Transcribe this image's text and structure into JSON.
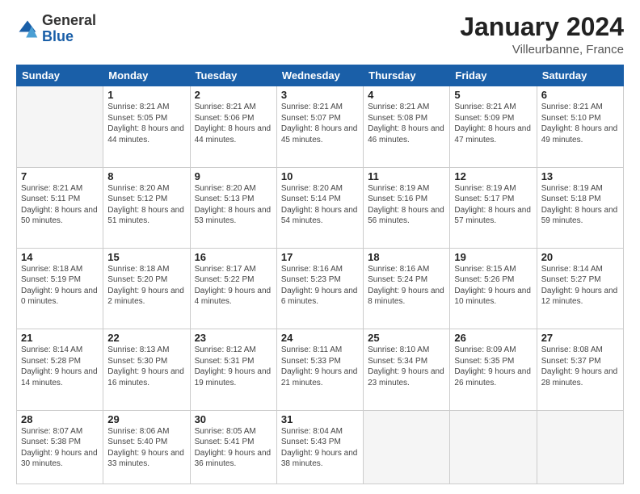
{
  "logo": {
    "general": "General",
    "blue": "Blue"
  },
  "header": {
    "month": "January 2024",
    "location": "Villeurbanne, France"
  },
  "weekdays": [
    "Sunday",
    "Monday",
    "Tuesday",
    "Wednesday",
    "Thursday",
    "Friday",
    "Saturday"
  ],
  "weeks": [
    [
      {
        "day": "",
        "sunrise": "",
        "sunset": "",
        "daylight": "",
        "empty": true
      },
      {
        "day": "1",
        "sunrise": "Sunrise: 8:21 AM",
        "sunset": "Sunset: 5:05 PM",
        "daylight": "Daylight: 8 hours and 44 minutes.",
        "empty": false
      },
      {
        "day": "2",
        "sunrise": "Sunrise: 8:21 AM",
        "sunset": "Sunset: 5:06 PM",
        "daylight": "Daylight: 8 hours and 44 minutes.",
        "empty": false
      },
      {
        "day": "3",
        "sunrise": "Sunrise: 8:21 AM",
        "sunset": "Sunset: 5:07 PM",
        "daylight": "Daylight: 8 hours and 45 minutes.",
        "empty": false
      },
      {
        "day": "4",
        "sunrise": "Sunrise: 8:21 AM",
        "sunset": "Sunset: 5:08 PM",
        "daylight": "Daylight: 8 hours and 46 minutes.",
        "empty": false
      },
      {
        "day": "5",
        "sunrise": "Sunrise: 8:21 AM",
        "sunset": "Sunset: 5:09 PM",
        "daylight": "Daylight: 8 hours and 47 minutes.",
        "empty": false
      },
      {
        "day": "6",
        "sunrise": "Sunrise: 8:21 AM",
        "sunset": "Sunset: 5:10 PM",
        "daylight": "Daylight: 8 hours and 49 minutes.",
        "empty": false
      }
    ],
    [
      {
        "day": "7",
        "sunrise": "Sunrise: 8:21 AM",
        "sunset": "Sunset: 5:11 PM",
        "daylight": "Daylight: 8 hours and 50 minutes.",
        "empty": false
      },
      {
        "day": "8",
        "sunrise": "Sunrise: 8:20 AM",
        "sunset": "Sunset: 5:12 PM",
        "daylight": "Daylight: 8 hours and 51 minutes.",
        "empty": false
      },
      {
        "day": "9",
        "sunrise": "Sunrise: 8:20 AM",
        "sunset": "Sunset: 5:13 PM",
        "daylight": "Daylight: 8 hours and 53 minutes.",
        "empty": false
      },
      {
        "day": "10",
        "sunrise": "Sunrise: 8:20 AM",
        "sunset": "Sunset: 5:14 PM",
        "daylight": "Daylight: 8 hours and 54 minutes.",
        "empty": false
      },
      {
        "day": "11",
        "sunrise": "Sunrise: 8:19 AM",
        "sunset": "Sunset: 5:16 PM",
        "daylight": "Daylight: 8 hours and 56 minutes.",
        "empty": false
      },
      {
        "day": "12",
        "sunrise": "Sunrise: 8:19 AM",
        "sunset": "Sunset: 5:17 PM",
        "daylight": "Daylight: 8 hours and 57 minutes.",
        "empty": false
      },
      {
        "day": "13",
        "sunrise": "Sunrise: 8:19 AM",
        "sunset": "Sunset: 5:18 PM",
        "daylight": "Daylight: 8 hours and 59 minutes.",
        "empty": false
      }
    ],
    [
      {
        "day": "14",
        "sunrise": "Sunrise: 8:18 AM",
        "sunset": "Sunset: 5:19 PM",
        "daylight": "Daylight: 9 hours and 0 minutes.",
        "empty": false
      },
      {
        "day": "15",
        "sunrise": "Sunrise: 8:18 AM",
        "sunset": "Sunset: 5:20 PM",
        "daylight": "Daylight: 9 hours and 2 minutes.",
        "empty": false
      },
      {
        "day": "16",
        "sunrise": "Sunrise: 8:17 AM",
        "sunset": "Sunset: 5:22 PM",
        "daylight": "Daylight: 9 hours and 4 minutes.",
        "empty": false
      },
      {
        "day": "17",
        "sunrise": "Sunrise: 8:16 AM",
        "sunset": "Sunset: 5:23 PM",
        "daylight": "Daylight: 9 hours and 6 minutes.",
        "empty": false
      },
      {
        "day": "18",
        "sunrise": "Sunrise: 8:16 AM",
        "sunset": "Sunset: 5:24 PM",
        "daylight": "Daylight: 9 hours and 8 minutes.",
        "empty": false
      },
      {
        "day": "19",
        "sunrise": "Sunrise: 8:15 AM",
        "sunset": "Sunset: 5:26 PM",
        "daylight": "Daylight: 9 hours and 10 minutes.",
        "empty": false
      },
      {
        "day": "20",
        "sunrise": "Sunrise: 8:14 AM",
        "sunset": "Sunset: 5:27 PM",
        "daylight": "Daylight: 9 hours and 12 minutes.",
        "empty": false
      }
    ],
    [
      {
        "day": "21",
        "sunrise": "Sunrise: 8:14 AM",
        "sunset": "Sunset: 5:28 PM",
        "daylight": "Daylight: 9 hours and 14 minutes.",
        "empty": false
      },
      {
        "day": "22",
        "sunrise": "Sunrise: 8:13 AM",
        "sunset": "Sunset: 5:30 PM",
        "daylight": "Daylight: 9 hours and 16 minutes.",
        "empty": false
      },
      {
        "day": "23",
        "sunrise": "Sunrise: 8:12 AM",
        "sunset": "Sunset: 5:31 PM",
        "daylight": "Daylight: 9 hours and 19 minutes.",
        "empty": false
      },
      {
        "day": "24",
        "sunrise": "Sunrise: 8:11 AM",
        "sunset": "Sunset: 5:33 PM",
        "daylight": "Daylight: 9 hours and 21 minutes.",
        "empty": false
      },
      {
        "day": "25",
        "sunrise": "Sunrise: 8:10 AM",
        "sunset": "Sunset: 5:34 PM",
        "daylight": "Daylight: 9 hours and 23 minutes.",
        "empty": false
      },
      {
        "day": "26",
        "sunrise": "Sunrise: 8:09 AM",
        "sunset": "Sunset: 5:35 PM",
        "daylight": "Daylight: 9 hours and 26 minutes.",
        "empty": false
      },
      {
        "day": "27",
        "sunrise": "Sunrise: 8:08 AM",
        "sunset": "Sunset: 5:37 PM",
        "daylight": "Daylight: 9 hours and 28 minutes.",
        "empty": false
      }
    ],
    [
      {
        "day": "28",
        "sunrise": "Sunrise: 8:07 AM",
        "sunset": "Sunset: 5:38 PM",
        "daylight": "Daylight: 9 hours and 30 minutes.",
        "empty": false
      },
      {
        "day": "29",
        "sunrise": "Sunrise: 8:06 AM",
        "sunset": "Sunset: 5:40 PM",
        "daylight": "Daylight: 9 hours and 33 minutes.",
        "empty": false
      },
      {
        "day": "30",
        "sunrise": "Sunrise: 8:05 AM",
        "sunset": "Sunset: 5:41 PM",
        "daylight": "Daylight: 9 hours and 36 minutes.",
        "empty": false
      },
      {
        "day": "31",
        "sunrise": "Sunrise: 8:04 AM",
        "sunset": "Sunset: 5:43 PM",
        "daylight": "Daylight: 9 hours and 38 minutes.",
        "empty": false
      },
      {
        "day": "",
        "sunrise": "",
        "sunset": "",
        "daylight": "",
        "empty": true
      },
      {
        "day": "",
        "sunrise": "",
        "sunset": "",
        "daylight": "",
        "empty": true
      },
      {
        "day": "",
        "sunrise": "",
        "sunset": "",
        "daylight": "",
        "empty": true
      }
    ]
  ]
}
